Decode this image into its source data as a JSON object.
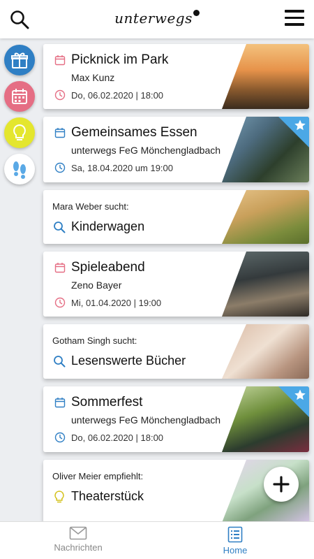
{
  "header": {
    "logo": "unterwegs"
  },
  "sidebar": {
    "items": [
      {
        "name": "gift",
        "color": "#2f7fc4"
      },
      {
        "name": "calendar",
        "color": "#e56e84"
      },
      {
        "name": "lightbulb",
        "color": "#e4e62e"
      },
      {
        "name": "footprints",
        "color": "#ffffff"
      }
    ]
  },
  "cards": [
    {
      "type": "event",
      "title": "Picknick im Park",
      "subtitle": "Max Kunz",
      "date": "Do, 06.02.2020 | 18:00",
      "icon_color": "#e56e84",
      "starred": false
    },
    {
      "type": "event",
      "title": "Gemeinsames Essen",
      "subtitle": "unterwegs FeG Mönchengladbach",
      "date": "Sa, 18.04.2020 um 19:00",
      "icon_color": "#2f7fc4",
      "starred": true
    },
    {
      "type": "search",
      "person": "Mara Weber",
      "verb": "sucht:",
      "title": "Kinderwagen"
    },
    {
      "type": "event",
      "title": "Spieleabend",
      "subtitle": "Zeno Bayer",
      "date": "Mi, 01.04.2020 | 19:00",
      "icon_color": "#e56e84",
      "starred": false
    },
    {
      "type": "search",
      "person": "Gotham Singh",
      "verb": "sucht:",
      "title": "Lesenswerte Bücher"
    },
    {
      "type": "event",
      "title": "Sommerfest",
      "subtitle": "unterwegs FeG Mönchengladbach",
      "date": "Do, 06.02.2020 | 18:00",
      "icon_color": "#2f7fc4",
      "starred": true
    },
    {
      "type": "recommend",
      "person": "Oliver Meier",
      "verb": "empfiehlt:",
      "title": "Theaterstück"
    }
  ],
  "tabbar": {
    "messages": "Nachrichten",
    "home": "Home"
  },
  "colors": {
    "accent": "#2f7fc4",
    "pink": "#e56e84",
    "yellow": "#e4e62e",
    "star": "#4ba8e6"
  }
}
